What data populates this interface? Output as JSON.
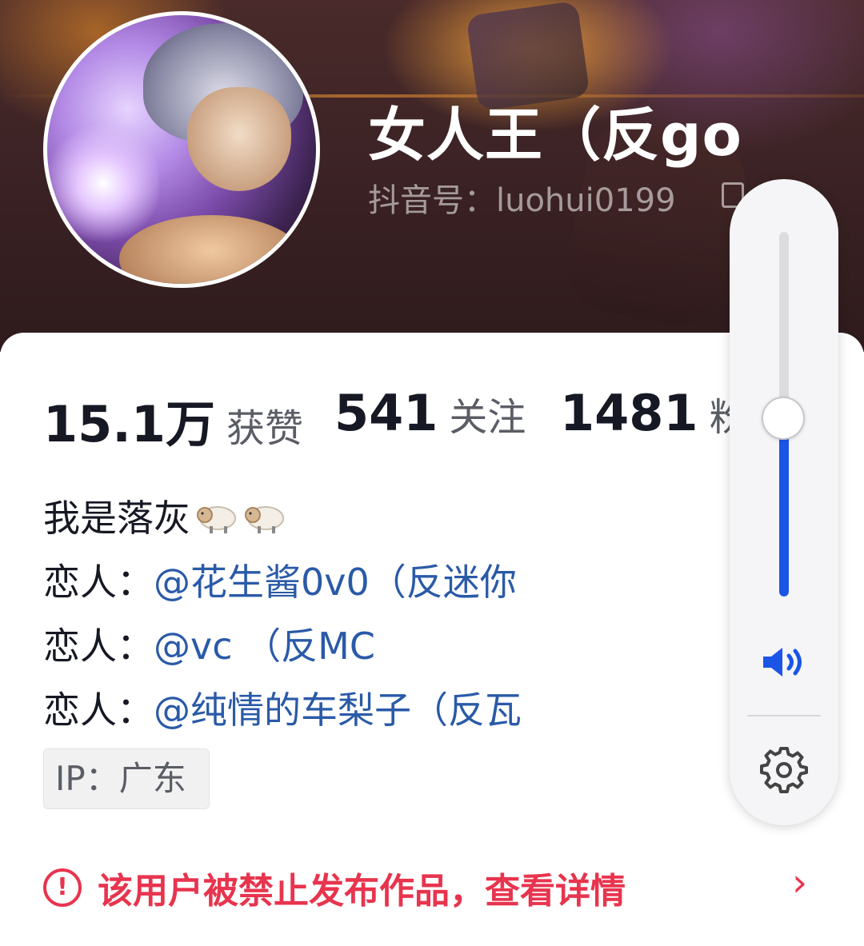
{
  "profile": {
    "name": "女人王（反go",
    "douyin_id_label": "抖音号：luohui0199"
  },
  "stats": [
    {
      "num": "15.1万",
      "label": "获赞"
    },
    {
      "num": "541",
      "label": "关注"
    },
    {
      "num": "1481",
      "label": "粉丝"
    }
  ],
  "bio": {
    "line1": "我是落灰",
    "lines": [
      {
        "prefix": "恋人：",
        "mention": "@花生酱0v0（反迷你"
      },
      {
        "prefix": "恋人：",
        "mention": "@vc （反MC"
      },
      {
        "prefix": "恋人：",
        "mention": "@纯情的车梨子（反瓦"
      }
    ]
  },
  "ip_tag": "IP：广东",
  "banned_notice": {
    "text": "该用户被禁止发布作品，查看详情",
    "icon": "exclamation-circle-icon",
    "chevron": "›"
  },
  "volume": {
    "level": 0.49,
    "accent": "#1a55e6"
  },
  "colors": {
    "warning": "#e8344e",
    "mention": "#2a5aa8"
  }
}
